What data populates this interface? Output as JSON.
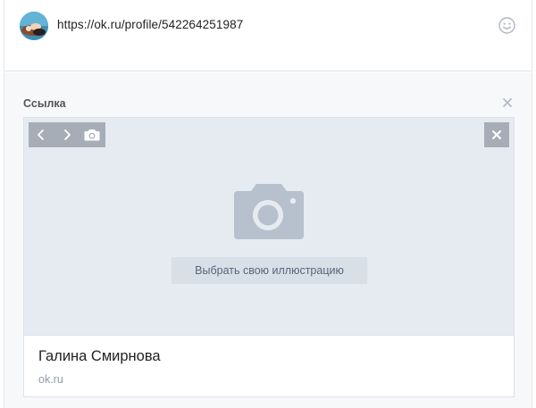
{
  "composer": {
    "url": "https://ok.ru/profile/542264251987",
    "avatar_icon": "user-avatar",
    "emoji_icon": "smile-icon"
  },
  "attachment": {
    "title": "Ссылка",
    "close_icon": "close-icon",
    "card": {
      "nav_prev_icon": "chevron-left-icon",
      "nav_next_icon": "chevron-right-icon",
      "camera_icon": "camera-icon",
      "cover_close_icon": "close-icon",
      "placeholder_icon": "camera-icon",
      "choose_label": "Выбрать свою иллюстрацию",
      "name": "Галина Смирнова",
      "domain": "ok.ru"
    }
  },
  "colors": {
    "cover_bg": "#e5ebf1",
    "button_bg": "#a6adb6",
    "choose_bg": "#d8dfe7",
    "choose_text": "#55677d",
    "panel_bg": "#f7f8fa"
  }
}
